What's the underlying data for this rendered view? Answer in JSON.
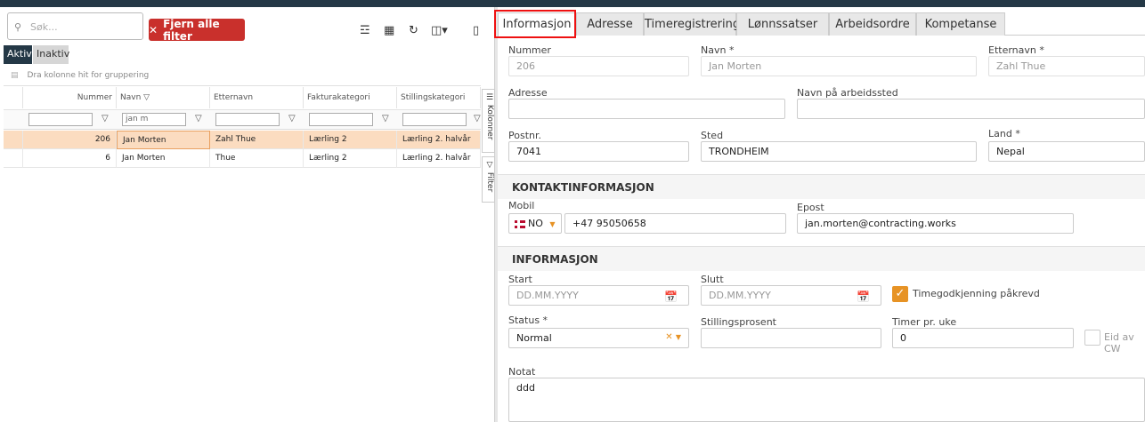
{
  "left": {
    "search_placeholder": "Søk...",
    "clear_filter_label": "Fjern alle filter",
    "status_tabs": [
      "Aktiv",
      "Inaktiv"
    ],
    "group_hint": "Dra kolonne hit for gruppering",
    "columns": [
      "Nummer",
      "Navn",
      "Etternavn",
      "Fakturakategori",
      "Stillingskategori"
    ],
    "filter_navn": "jan m",
    "rows": [
      {
        "nummer": "206",
        "navn": "Jan Morten",
        "etternavn": "Zahl Thue",
        "faktura": "Lærling 2",
        "stilling": "Lærling 2. halvår"
      },
      {
        "nummer": "6",
        "navn": "Jan Morten",
        "etternavn": "Thue",
        "faktura": "Lærling 2",
        "stilling": "Lærling 2. halvår"
      }
    ],
    "side_tabs": [
      "Kolonner",
      "Filter"
    ]
  },
  "tabs": [
    "Informasjon",
    "Adresse",
    "Timeregistrering",
    "Lønnssatser",
    "Arbeidsordre",
    "Kompetanse"
  ],
  "form": {
    "nummer_label": "Nummer",
    "nummer_value": "206",
    "navn_label": "Navn *",
    "navn_value": "Jan Morten",
    "etternavn_label": "Etternavn *",
    "etternavn_value": "Zahl Thue",
    "adresse_label": "Adresse",
    "arbeidssted_label": "Navn på arbeidssted",
    "postnr_label": "Postnr.",
    "postnr_value": "7041",
    "sted_label": "Sted",
    "sted_value": "TRONDHEIM",
    "land_label": "Land *",
    "land_value": "Nepal",
    "kontakt_title": "KONTAKTINFORMASJON",
    "mobil_label": "Mobil",
    "country_code": "NO",
    "mobil_value": "+47 95050658",
    "epost_label": "Epost",
    "epost_value": "jan.morten@contracting.works",
    "info_title": "INFORMASJON",
    "start_label": "Start",
    "start_placeholder": "DD.MM.YYYY",
    "slutt_label": "Slutt",
    "slutt_placeholder": "DD.MM.YYYY",
    "timegodkjenning_label": "Timegodkjenning påkrevd",
    "status_label": "Status *",
    "status_value": "Normal",
    "stillingsprosent_label": "Stillingsprosent",
    "timer_label": "Timer pr. uke",
    "timer_value": "0",
    "eid_label": "Eid av CW",
    "notat_label": "Notat",
    "notat_value": "ddd"
  },
  "colors": {
    "accent": "#e79325",
    "danger": "#c9302c",
    "header": "#243846",
    "selected_row": "#fbdcc0",
    "highlight_box": "#e11111"
  },
  "icons": [
    "search-icon",
    "close-icon",
    "filter-icon",
    "calendar-icon",
    "check-icon",
    "chevron-down-icon"
  ]
}
